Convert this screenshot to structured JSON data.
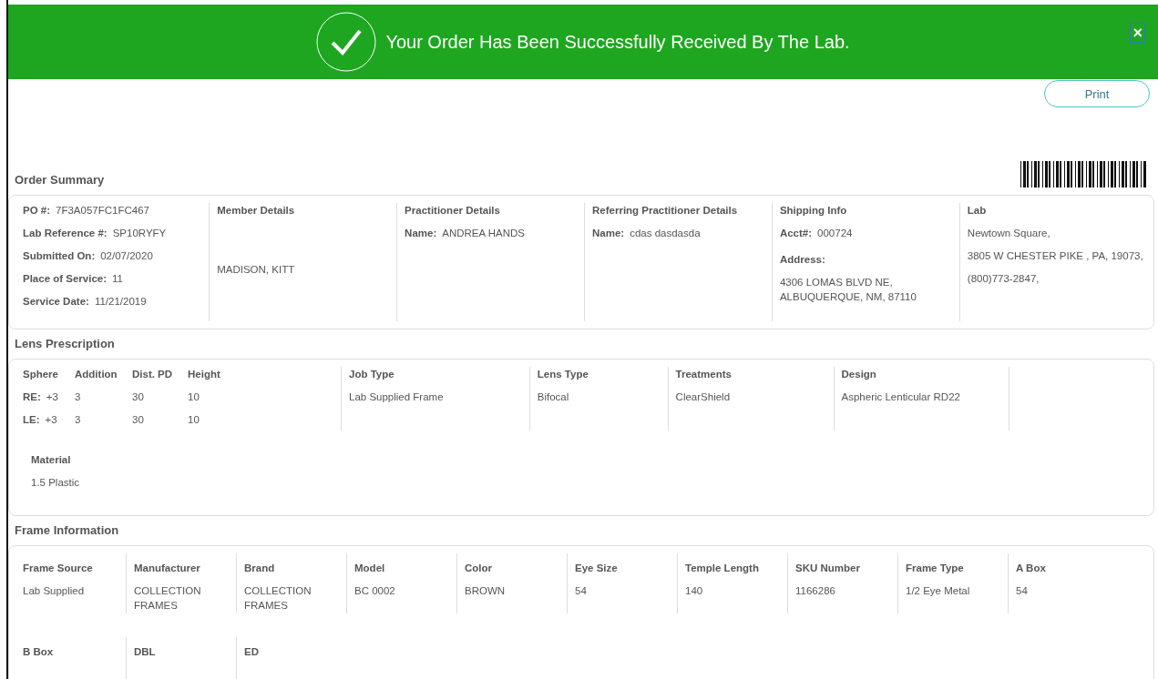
{
  "banner": {
    "message": "Your Order Has Been Successfully Received By The Lab.",
    "close": "×"
  },
  "print_button": "Print",
  "order_summary": {
    "title": "Order Summary",
    "columns": [
      {
        "items": [
          {
            "kind": "field",
            "label": "PO #:",
            "value": "7F3A057FC1FC467"
          },
          {
            "kind": "field",
            "label": "Lab Reference #:",
            "value": "SP10RYFY"
          },
          {
            "kind": "field",
            "label": "Submitted On:",
            "value": "02/07/2020"
          },
          {
            "kind": "field",
            "label": "Place of Service:",
            "value": "11"
          },
          {
            "kind": "field",
            "label": "Service Date:",
            "value": "11/21/2019"
          }
        ]
      },
      {
        "title": "Member Details",
        "items": [
          {
            "kind": "centered",
            "value": "MADISON, KITT"
          }
        ]
      },
      {
        "title": "Practitioner Details",
        "items": [
          {
            "kind": "field",
            "label": "Name:",
            "value": "ANDREA HANDS"
          }
        ]
      },
      {
        "title": "Referring Practitioner Details",
        "items": [
          {
            "kind": "field",
            "label": "Name:",
            "value": "cdas dasdasda"
          }
        ]
      },
      {
        "title": "Shipping Info",
        "items": [
          {
            "kind": "field",
            "label": "Acct#:",
            "value": "000724"
          },
          {
            "kind": "heading",
            "value": "Address:"
          },
          {
            "kind": "text",
            "value": "4306 LOMAS BLVD NE,\nALBUQUERQUE, NM, 87110"
          }
        ]
      },
      {
        "title": "Lab",
        "items": [
          {
            "kind": "text",
            "value": "Newtown Square,"
          },
          {
            "kind": "text",
            "value": "3805 W CHESTER PIKE , PA, 19073,"
          },
          {
            "kind": "text",
            "value": "(800)773-2847,"
          }
        ]
      }
    ]
  },
  "lens_prescription": {
    "title": "Lens Prescription",
    "rx": {
      "columns": [
        "Sphere",
        "Addition",
        "Dist. PD",
        "Height"
      ],
      "rows": [
        {
          "eye": "RE:",
          "values": [
            "+3",
            "3",
            "30",
            "10"
          ]
        },
        {
          "eye": "LE:",
          "values": [
            "+3",
            "3",
            "30",
            "10"
          ]
        }
      ]
    },
    "fields": [
      {
        "label": "Job Type",
        "value": "Lab Supplied Frame"
      },
      {
        "label": "Lens Type",
        "value": "Bifocal"
      },
      {
        "label": "Treatments",
        "value": "ClearShield"
      },
      {
        "label": "Design",
        "value": "Aspheric Lenticular RD22"
      }
    ],
    "material": {
      "label": "Material",
      "value": "1.5 Plastic"
    }
  },
  "frame_information": {
    "title": "Frame Information",
    "fields": [
      {
        "label": "Frame Source",
        "value": "Lab Supplied"
      },
      {
        "label": "Manufacturer",
        "value": "COLLECTION\nFRAMES"
      },
      {
        "label": "Brand",
        "value": "COLLECTION\nFRAMES"
      },
      {
        "label": "Model",
        "value": "BC 0002"
      },
      {
        "label": "Color",
        "value": "BROWN"
      },
      {
        "label": "Eye Size",
        "value": "54"
      },
      {
        "label": "Temple Length",
        "value": "140"
      },
      {
        "label": "SKU Number",
        "value": "1166286"
      },
      {
        "label": "Frame Type",
        "value": "1/2 Eye Metal"
      },
      {
        "label": "A Box",
        "value": "54"
      },
      {
        "label": "B Box"
      },
      {
        "label": "DBL"
      },
      {
        "label": "ED"
      }
    ]
  }
}
